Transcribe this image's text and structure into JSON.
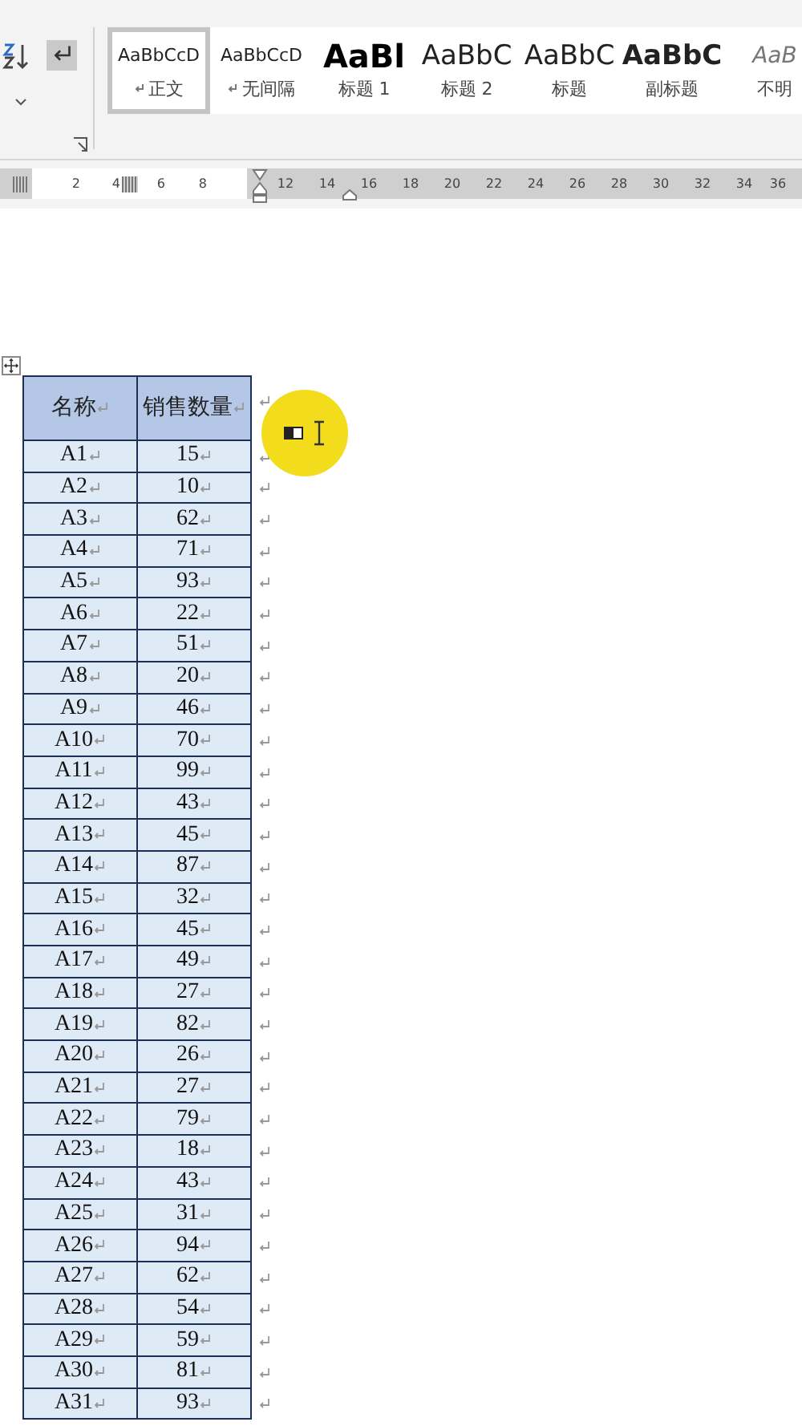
{
  "ribbon": {
    "styles": [
      {
        "preview": "AaBbCcD",
        "label": "正文",
        "kind": "body",
        "selected": true,
        "paragraph_style": true
      },
      {
        "preview": "AaBbCcD",
        "label": "无间隔",
        "kind": "nospacing",
        "selected": false,
        "paragraph_style": true
      },
      {
        "preview": "AaBl",
        "label": "标题 1",
        "kind": "heading1",
        "selected": false,
        "paragraph_style": false
      },
      {
        "preview": "AaBbC",
        "label": "标题 2",
        "kind": "heading2",
        "selected": false,
        "paragraph_style": false
      },
      {
        "preview": "AaBbC",
        "label": "标题",
        "kind": "title",
        "selected": false,
        "paragraph_style": false
      },
      {
        "preview": "AaBbC",
        "label": "副标题",
        "kind": "subtitle",
        "selected": false,
        "paragraph_style": false
      },
      {
        "preview": "AaB",
        "label": "不明",
        "kind": "subtle",
        "selected": false,
        "paragraph_style": false
      }
    ]
  },
  "ruler": {
    "ticks": [
      "2",
      "4",
      "6",
      "8",
      "12",
      "14",
      "16",
      "18",
      "20",
      "22",
      "24",
      "26",
      "28",
      "30",
      "32",
      "34",
      "36"
    ]
  },
  "table": {
    "columns": [
      "名称",
      "销售数量"
    ],
    "rows": [
      [
        "A1",
        "15"
      ],
      [
        "A2",
        "10"
      ],
      [
        "A3",
        "62"
      ],
      [
        "A4",
        "71"
      ],
      [
        "A5",
        "93"
      ],
      [
        "A6",
        "22"
      ],
      [
        "A7",
        "51"
      ],
      [
        "A8",
        "20"
      ],
      [
        "A9",
        "46"
      ],
      [
        "A10",
        "70"
      ],
      [
        "A11",
        "99"
      ],
      [
        "A12",
        "43"
      ],
      [
        "A13",
        "45"
      ],
      [
        "A14",
        "87"
      ],
      [
        "A15",
        "32"
      ],
      [
        "A16",
        "45"
      ],
      [
        "A17",
        "49"
      ],
      [
        "A18",
        "27"
      ],
      [
        "A19",
        "82"
      ],
      [
        "A20",
        "26"
      ],
      [
        "A21",
        "27"
      ],
      [
        "A22",
        "79"
      ],
      [
        "A23",
        "18"
      ],
      [
        "A24",
        "43"
      ],
      [
        "A25",
        "31"
      ],
      [
        "A26",
        "94"
      ],
      [
        "A27",
        "62"
      ],
      [
        "A28",
        "54"
      ],
      [
        "A29",
        "59"
      ],
      [
        "A30",
        "81"
      ],
      [
        "A31",
        "93"
      ]
    ]
  }
}
